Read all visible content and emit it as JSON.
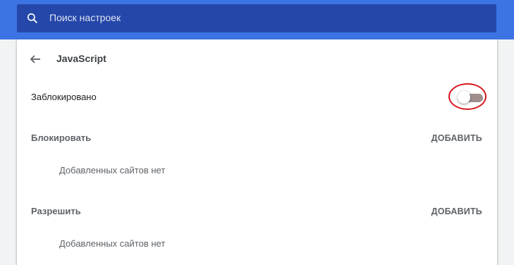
{
  "search": {
    "placeholder": "Поиск настроек",
    "icon": "search-icon"
  },
  "header": {
    "back_icon": "arrow-back-icon",
    "title": "JavaScript"
  },
  "main_toggle": {
    "label": "Заблокировано",
    "state": "off"
  },
  "block_section": {
    "title": "Блокировать",
    "add_label": "ДОБАВИТЬ",
    "empty_text": "Добавленных сайтов нет"
  },
  "allow_section": {
    "title": "Разрешить",
    "add_label": "ДОБАВИТЬ",
    "empty_text": "Добавленных сайтов нет"
  },
  "colors": {
    "topbar": "#3c74e4",
    "search_box": "#2547a9",
    "highlight_ring": "#d8141c"
  }
}
